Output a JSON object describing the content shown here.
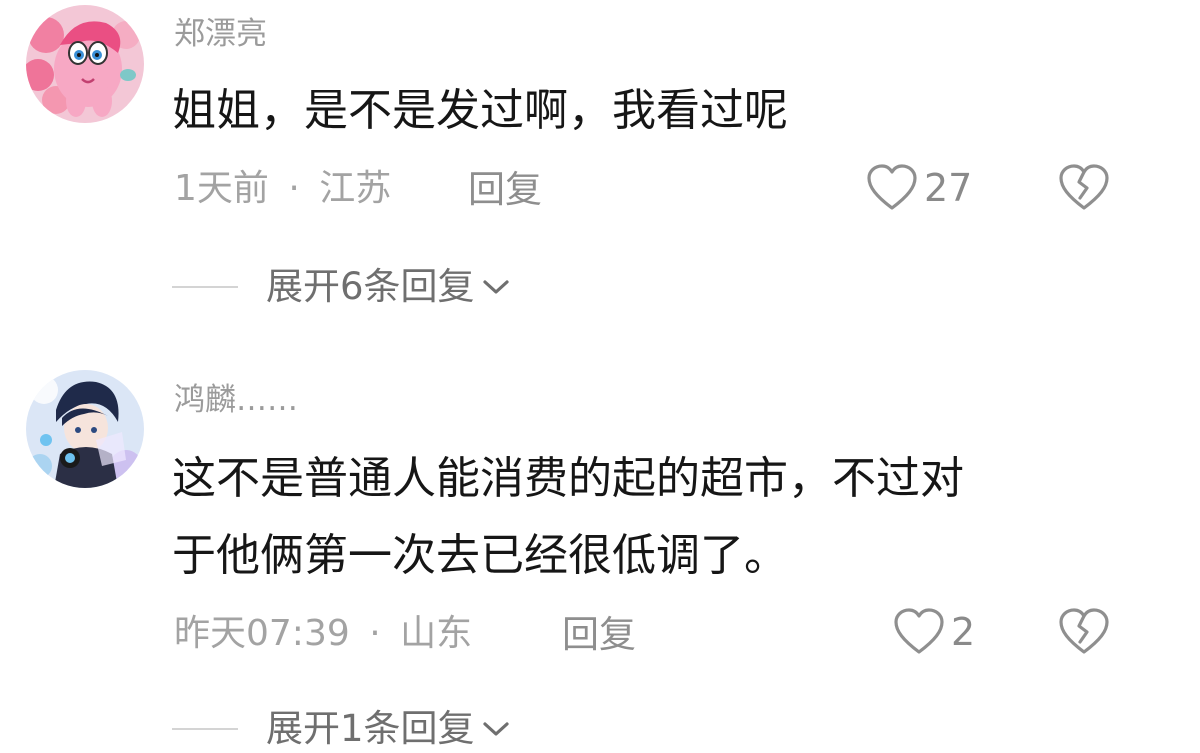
{
  "comments": [
    {
      "username": "郑漂亮",
      "text_lines": [
        "姐姐，是不是发过啊，我看过呢"
      ],
      "time": "1天前",
      "separator": "·",
      "location": "江苏",
      "reply_label": "回复",
      "like_count": "27",
      "expand_label": "展开6条回复",
      "avatar_icon": "pink-pony-avatar"
    },
    {
      "username": "鸿麟……",
      "text_lines": [
        "这不是普通人能消费的起的超市，不过对",
        "于他俩第一次去已经很低调了。"
      ],
      "time": "昨天07:39",
      "separator": "·",
      "location": "山东",
      "reply_label": "回复",
      "like_count": "2",
      "expand_label": "展开1条回复",
      "avatar_icon": "anime-boy-headphones-avatar"
    }
  ],
  "icons": {
    "like": "heart-outline-icon",
    "dislike": "broken-heart-icon",
    "expand": "chevron-down-icon"
  },
  "colors": {
    "username": "#9b9b9b",
    "text": "#161616",
    "meta": "#a3a3a3",
    "divider": "#d4d4d4"
  }
}
